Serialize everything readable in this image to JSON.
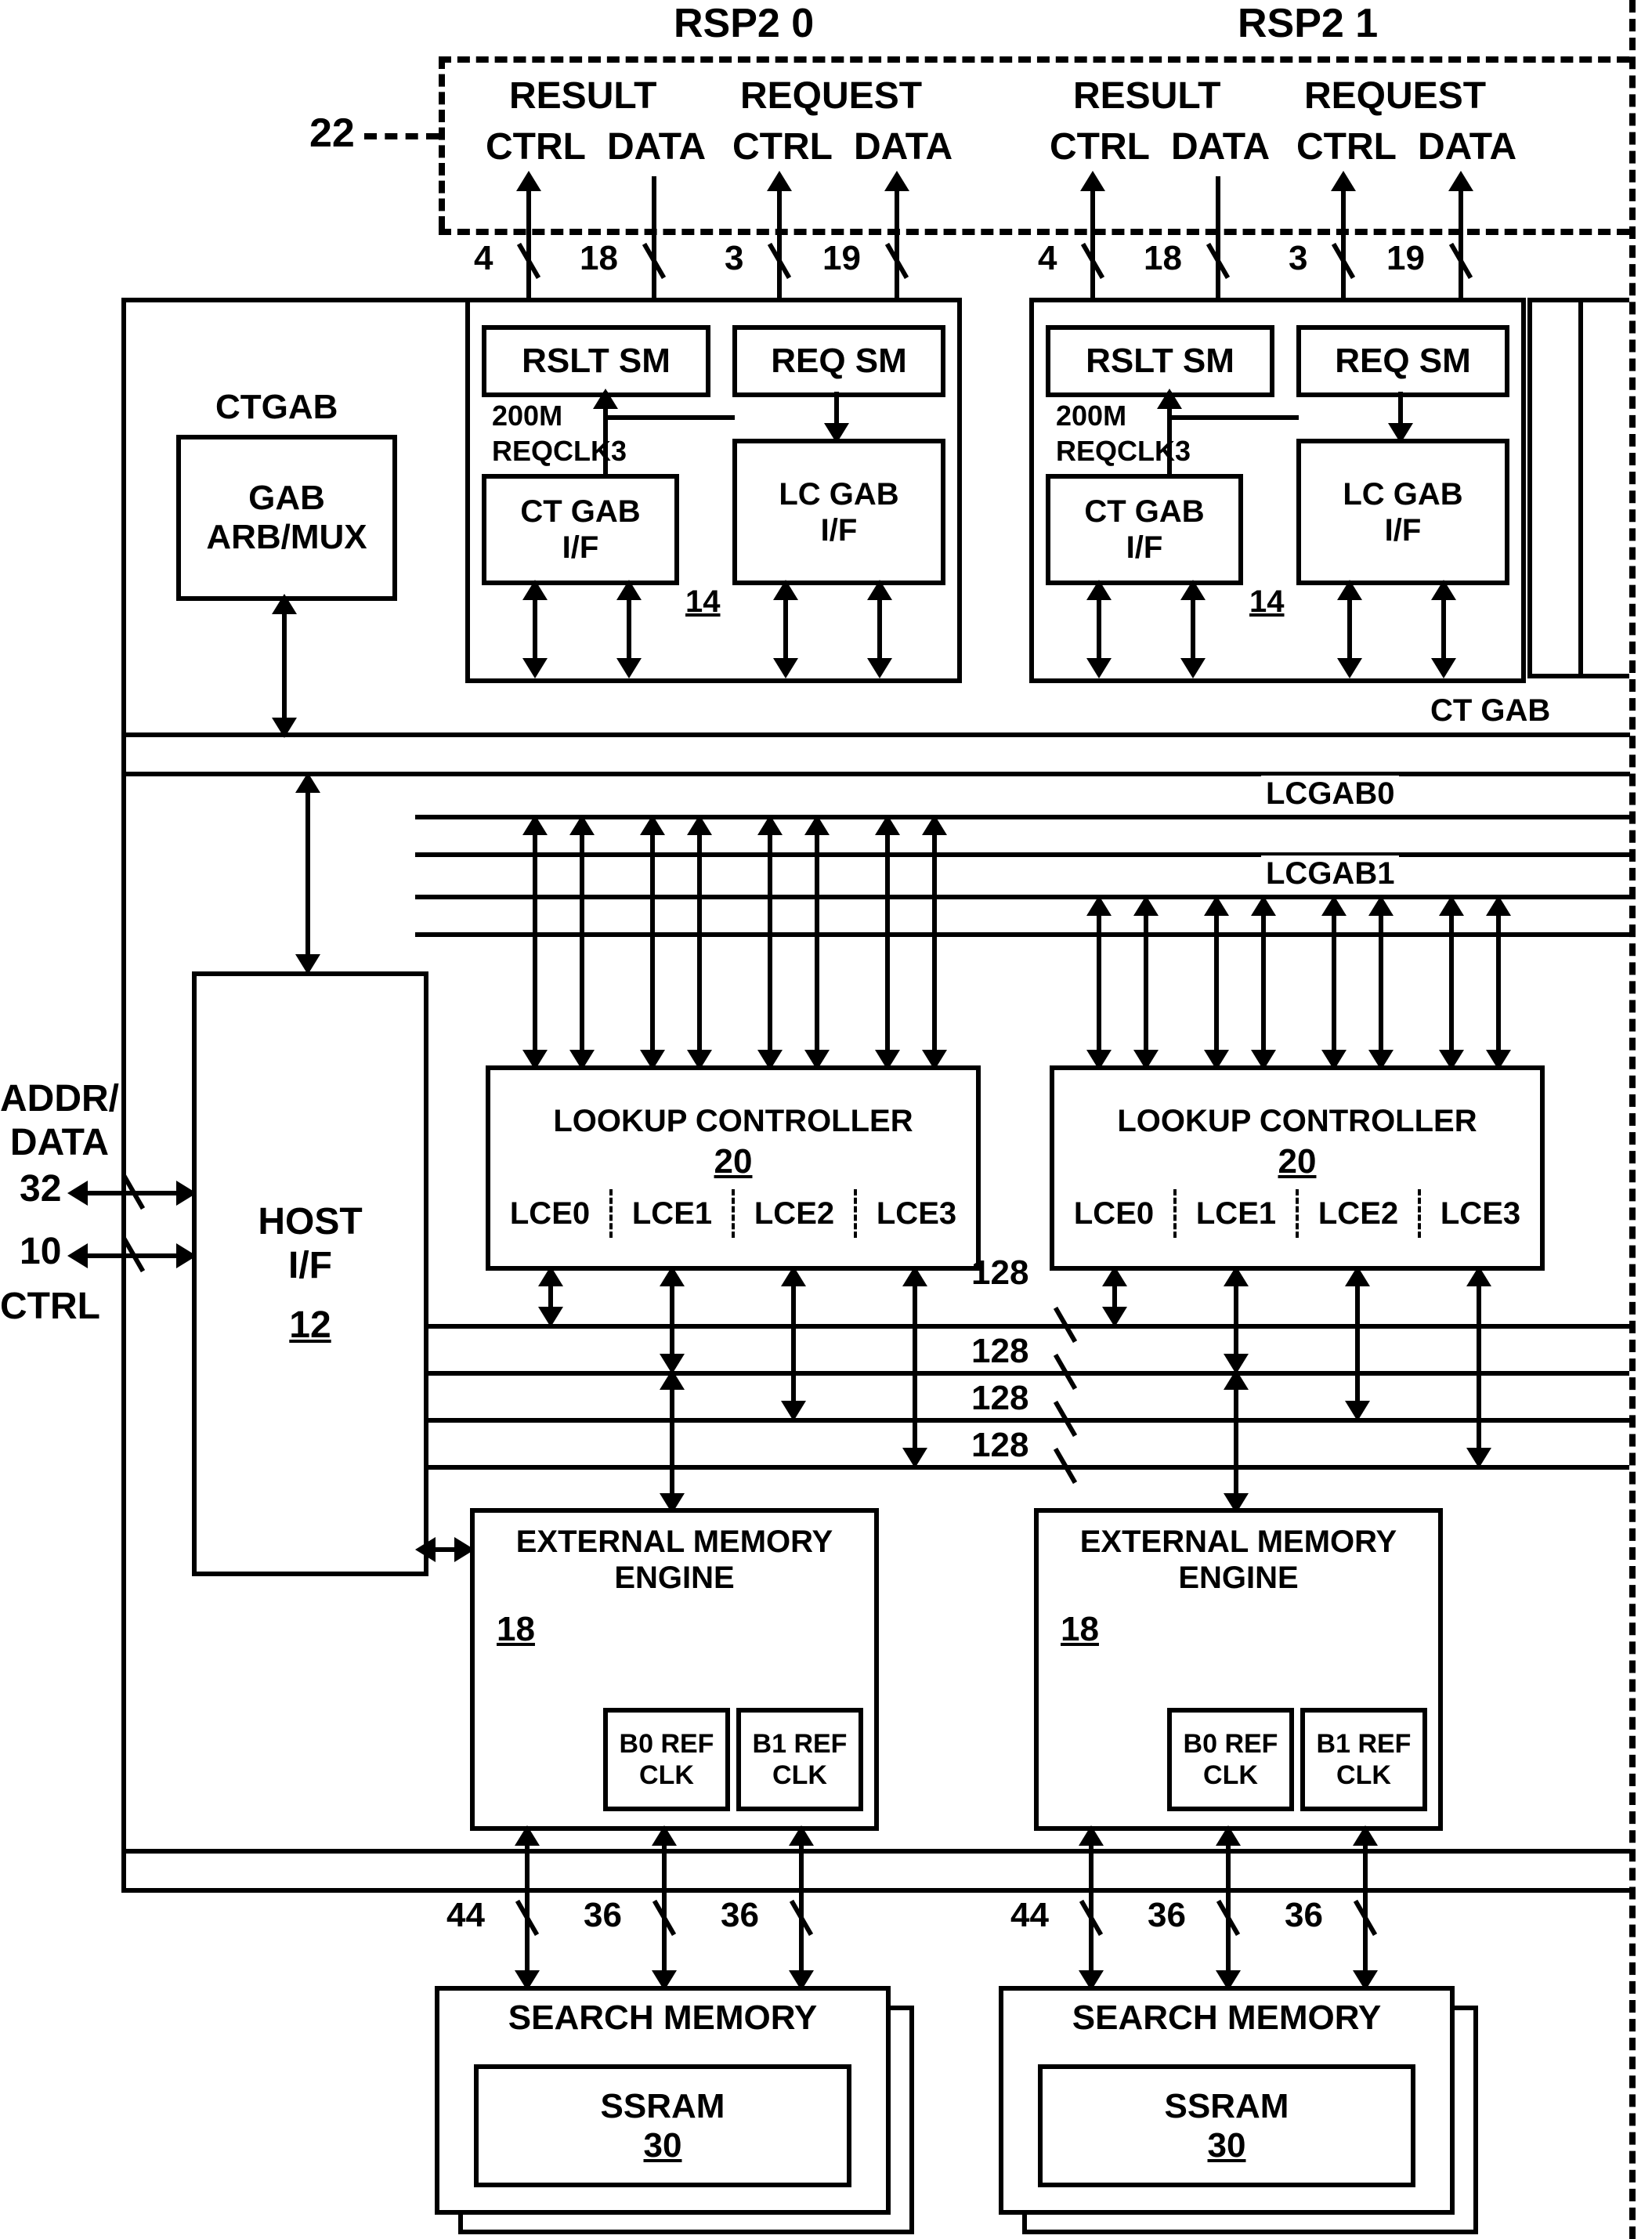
{
  "top": {
    "rsp2_0": "RSP2 0",
    "rsp2_1": "RSP2 1",
    "result": "RESULT",
    "request": "REQUEST",
    "ctrl": "CTRL",
    "data": "DATA",
    "ref22": "22"
  },
  "bus_widths": {
    "w4": "4",
    "w18": "18",
    "w3": "3",
    "w19": "19",
    "w44": "44",
    "w36": "36",
    "w128": "128",
    "w32": "32",
    "w10": "10"
  },
  "ctgab_block": {
    "title": "CTGAB",
    "body1": "GAB",
    "body2": "ARB/MUX"
  },
  "rsp_internal": {
    "rslt_sm": "RSLT SM",
    "req_sm": "REQ SM",
    "m200": "200M",
    "reqclk3": "REQCLK3",
    "ct_gab_if_1": "CT GAB",
    "ct_gab_if_2": "I/F",
    "lc_gab_if_1": "LC GAB",
    "lc_gab_if_2": "I/F",
    "ref14": "14"
  },
  "buses": {
    "ct_gab": "CT GAB",
    "lcgab0": "LCGAB0",
    "lcgab1": "LCGAB1"
  },
  "left": {
    "addr_data": "ADDR/\nDATA",
    "n32": "32",
    "n10": "10",
    "ctrl": "CTRL"
  },
  "host": {
    "title": "HOST",
    "if": "I/F",
    "ref12": "12"
  },
  "lookup": {
    "title": "LOOKUP CONTROLLER",
    "ref20": "20",
    "lce": [
      "LCE0",
      "LCE1",
      "LCE2",
      "LCE3"
    ]
  },
  "eme": {
    "title": "EXTERNAL MEMORY\nENGINE",
    "ref18": "18",
    "b0": "B0 REF\nCLK",
    "b1": "B1 REF\nCLK"
  },
  "search": {
    "title": "SEARCH MEMORY",
    "ssram": "SSRAM",
    "ref30": "30"
  }
}
